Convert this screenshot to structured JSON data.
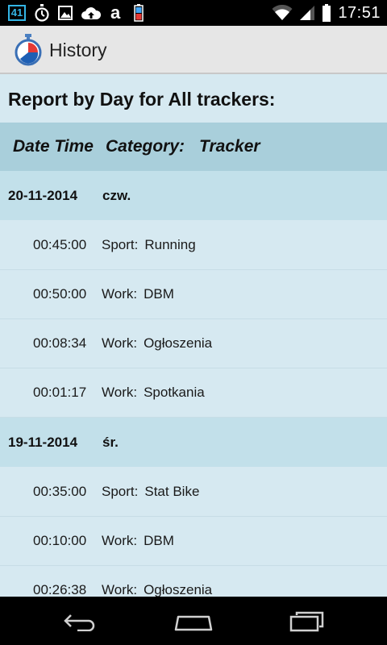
{
  "status_bar": {
    "notification_badge": "41",
    "time": "17:51",
    "icons_left": [
      "notification-count-icon",
      "stopwatch-icon",
      "image-icon",
      "cloud-upload-icon",
      "app-a-icon",
      "battery-saver-icon"
    ],
    "icons_right": [
      "wifi-icon",
      "cellular-signal-icon",
      "battery-icon"
    ]
  },
  "action_bar": {
    "title": "History",
    "app_icon": "stopwatch-pie-icon"
  },
  "report": {
    "title": "Report by Day for All trackers:",
    "headers": {
      "date_time": "Date Time",
      "category": "Category:",
      "tracker": "Tracker"
    },
    "days": [
      {
        "date": "20-11-2014",
        "weekday": "czw.",
        "entries": [
          {
            "duration": "00:45:00",
            "category": "Sport:",
            "tracker": "Running"
          },
          {
            "duration": "00:50:00",
            "category": "Work:",
            "tracker": "DBM"
          },
          {
            "duration": "00:08:34",
            "category": "Work:",
            "tracker": "Ogłoszenia"
          },
          {
            "duration": "00:01:17",
            "category": "Work:",
            "tracker": "Spotkania"
          }
        ]
      },
      {
        "date": "19-11-2014",
        "weekday": "śr.",
        "entries": [
          {
            "duration": "00:35:00",
            "category": "Sport:",
            "tracker": "Stat Bike"
          },
          {
            "duration": "00:10:00",
            "category": "Work:",
            "tracker": "DBM"
          },
          {
            "duration": "00:26:38",
            "category": "Work:",
            "tracker": "Ogłoszenia"
          }
        ]
      }
    ]
  },
  "nav_bar": {
    "buttons": [
      "back-icon",
      "home-icon",
      "recent-apps-icon"
    ]
  },
  "colors": {
    "background": "#d6e9f1",
    "header_row": "#a9cfdb",
    "day_row": "#c2e0ea",
    "action_bar": "#e6e6e6",
    "accent": "#33b5e5"
  }
}
